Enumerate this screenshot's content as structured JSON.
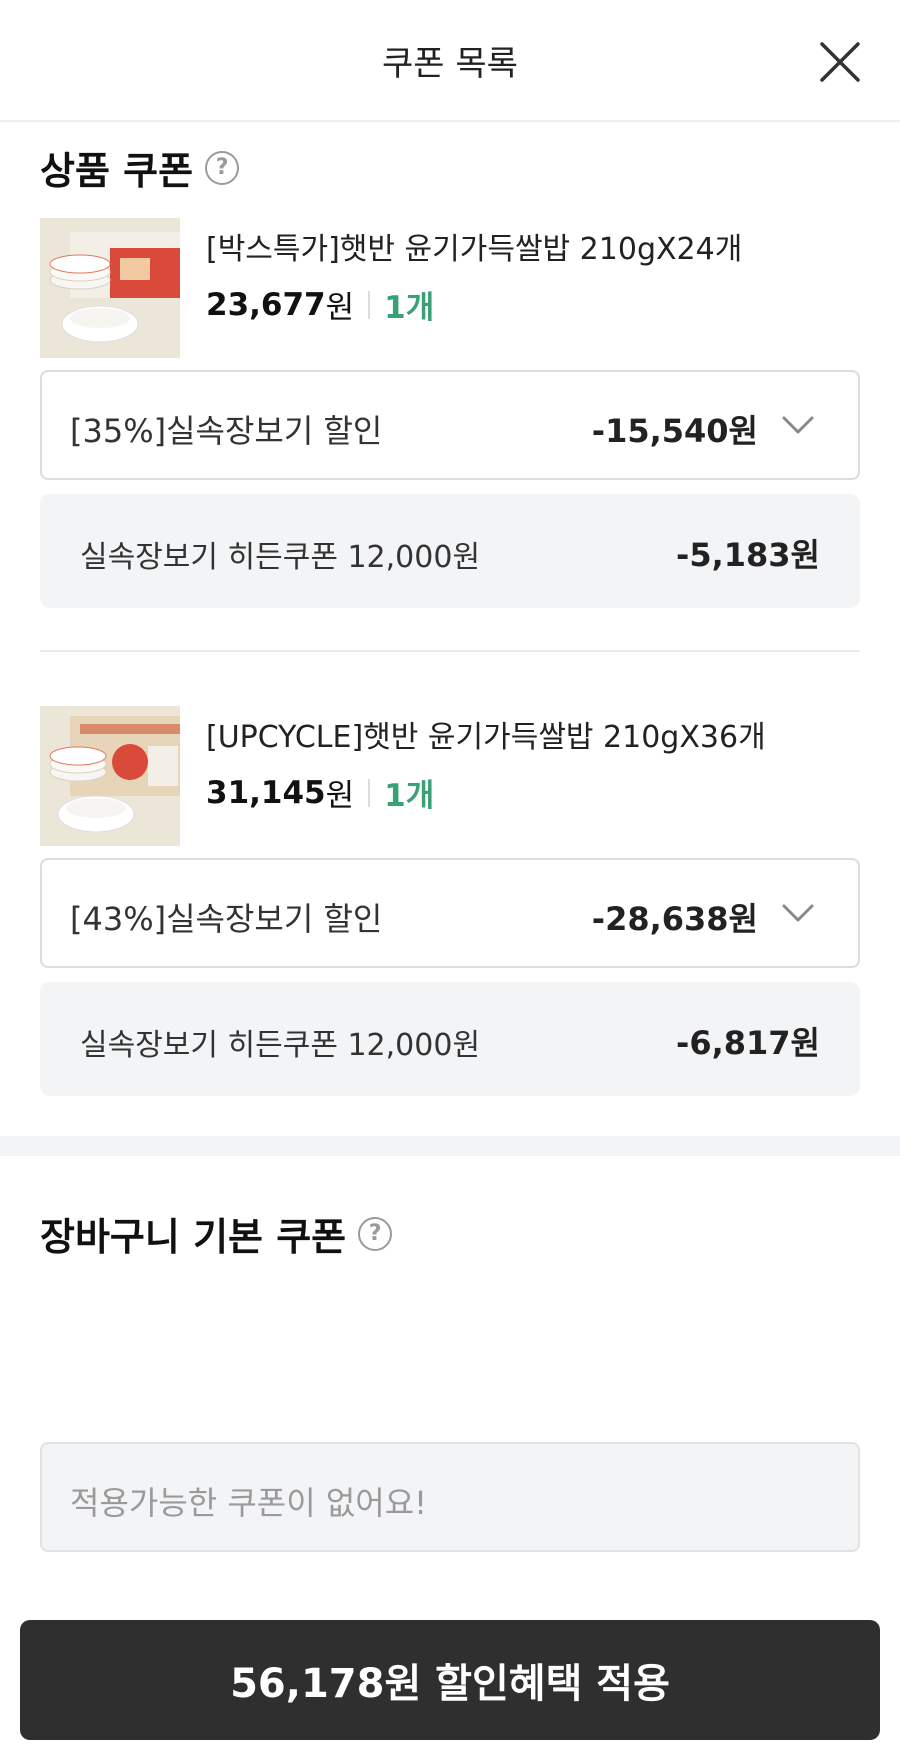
{
  "header": {
    "title": "쿠폰 목록"
  },
  "product_coupons": {
    "title": "상품 쿠폰",
    "items": [
      {
        "name": "[박스특가]햇반 윤기가득쌀밥 210gX24개",
        "price": "23,677",
        "price_unit": "원",
        "quantity": "1개",
        "selected_coupon": {
          "label": "[35%]실속장보기 할인",
          "amount": "-15,540원"
        },
        "hidden_coupon": {
          "label": "실속장보기 히든쿠폰 12,000원",
          "amount": "-5,183원"
        }
      },
      {
        "name": "[UPCYCLE]햇반 윤기가득쌀밥 210gX36개",
        "price": "31,145",
        "price_unit": "원",
        "quantity": "1개",
        "selected_coupon": {
          "label": "[43%]실속장보기 할인",
          "amount": "-28,638원"
        },
        "hidden_coupon": {
          "label": "실속장보기 히든쿠폰 12,000원",
          "amount": "-6,817원"
        }
      }
    ]
  },
  "cart_coupons": {
    "title": "장바구니 기본 쿠폰",
    "empty_message": "적용가능한 쿠폰이 없어요!"
  },
  "apply_button": {
    "label": "56,178원 할인혜택 적용"
  },
  "icons": {
    "close": "close-icon",
    "help": "help-icon",
    "chevron": "chevron-down-icon",
    "help_glyph": "?"
  },
  "colors": {
    "quantity_green": "#3aa076",
    "button_dark": "#2f2f2f",
    "panel_gray": "#f3f4f6"
  }
}
